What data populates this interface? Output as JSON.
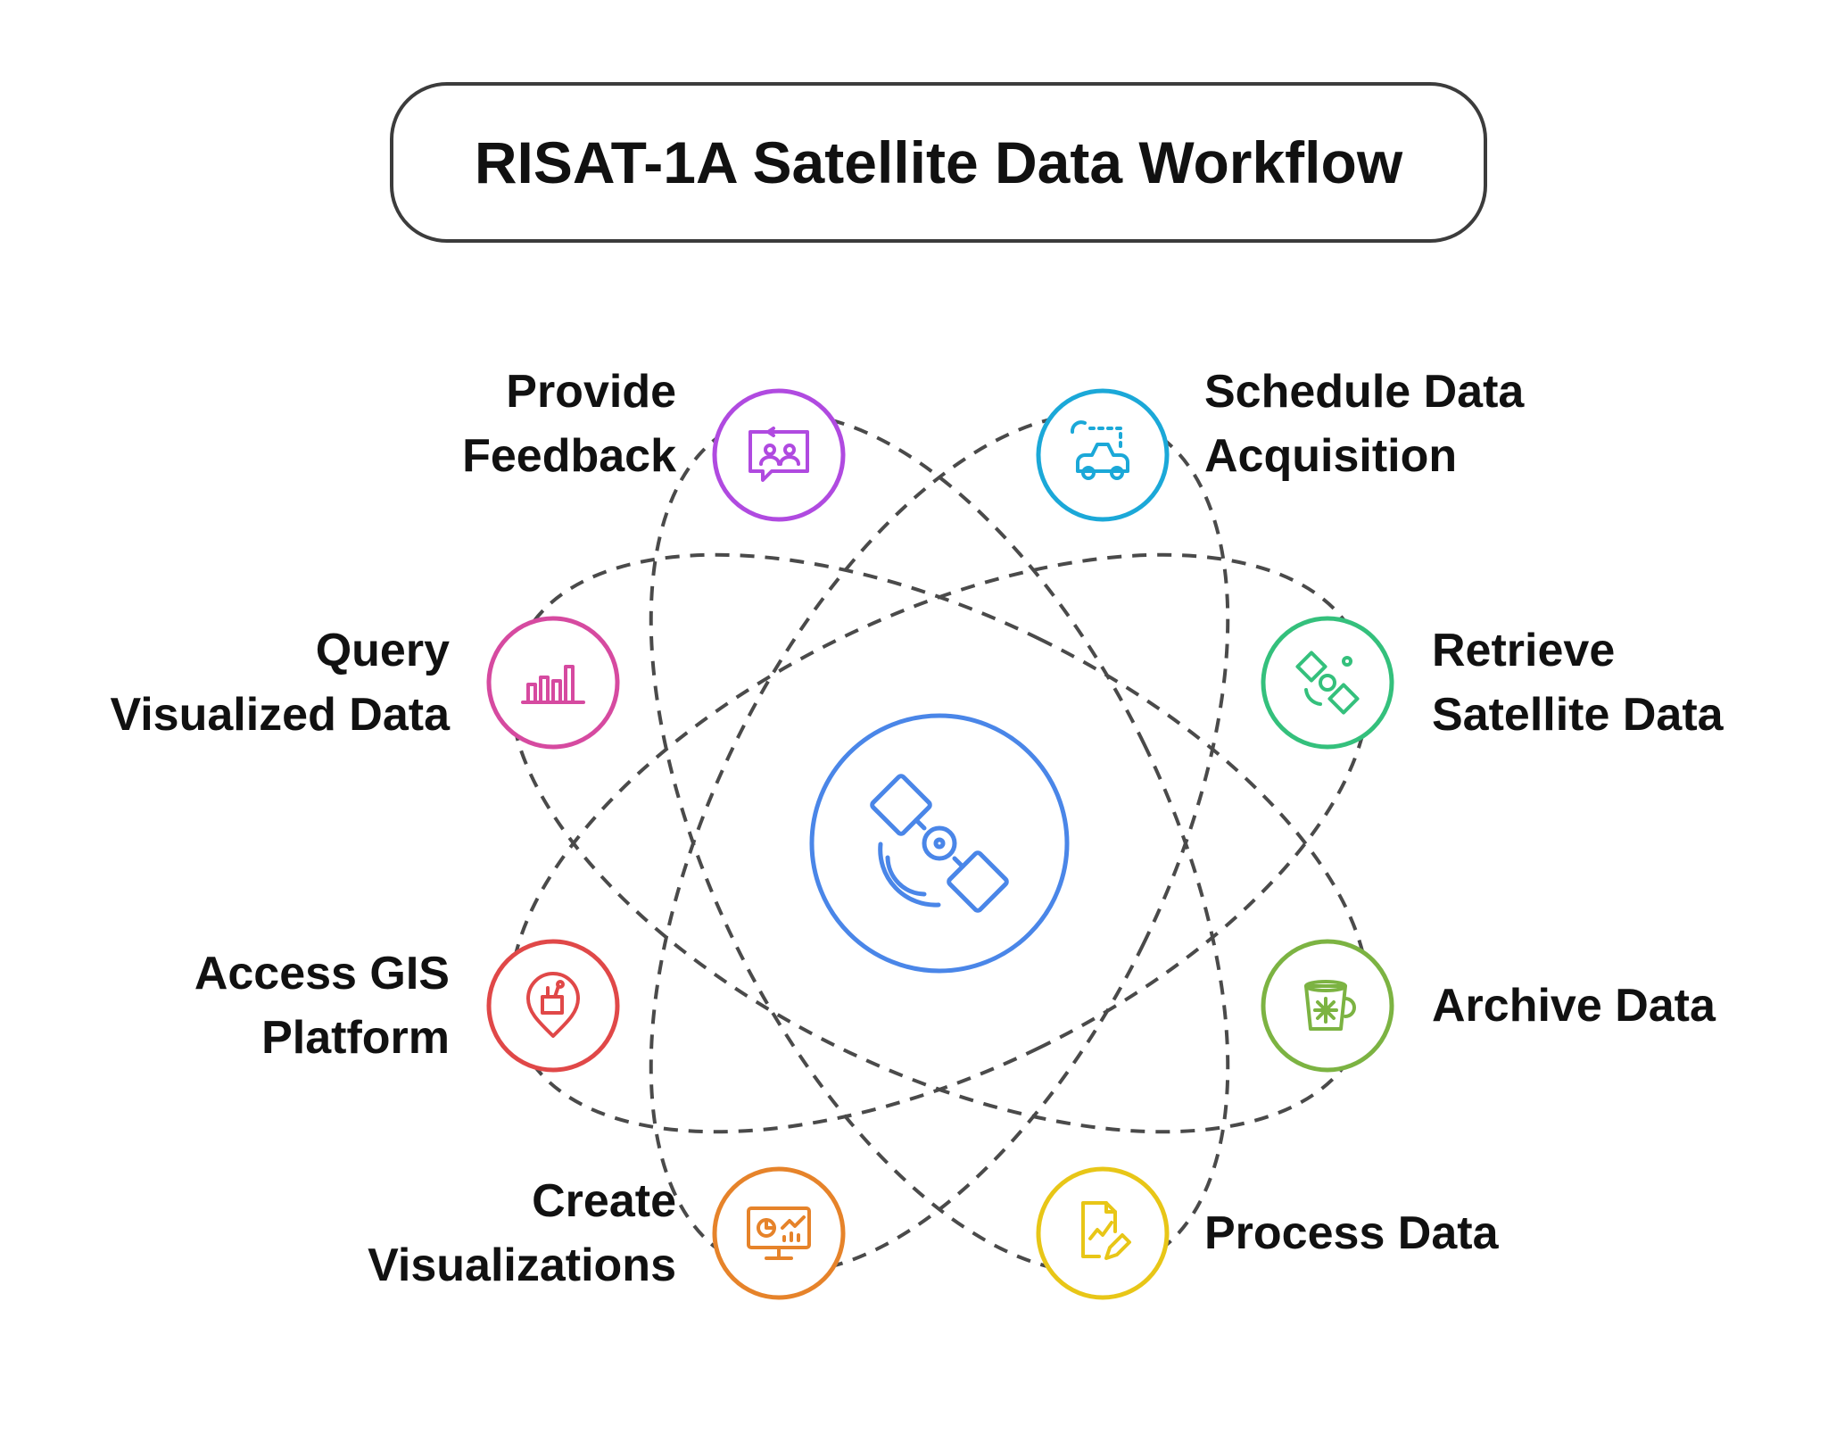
{
  "title": "RISAT-1A Satellite Data Workflow",
  "center": {
    "icon": "satellite-icon",
    "color": "#4a86e8"
  },
  "steps": [
    {
      "lines": [
        "Schedule Data",
        "Acquisition"
      ],
      "icon": "satellite-dish-car-icon",
      "color": "#1ba8d8"
    },
    {
      "lines": [
        "Retrieve",
        "Satellite Data"
      ],
      "icon": "satellite-icon",
      "color": "#34c07c"
    },
    {
      "lines": [
        "Archive Data"
      ],
      "icon": "snowflake-bucket-icon",
      "color": "#7cb342"
    },
    {
      "lines": [
        "Process Data"
      ],
      "icon": "document-edit-icon",
      "color": "#e8c617"
    },
    {
      "lines": [
        "Create",
        "Visualizations"
      ],
      "icon": "dashboard-monitor-icon",
      "color": "#e6832a"
    },
    {
      "lines": [
        "Access GIS",
        "Platform"
      ],
      "icon": "map-pin-tools-icon",
      "color": "#e04848"
    },
    {
      "lines": [
        "Query",
        "Visualized Data"
      ],
      "icon": "bar-chart-icon",
      "color": "#d64aa0"
    },
    {
      "lines": [
        "Provide",
        "Feedback"
      ],
      "icon": "feedback-users-icon",
      "color": "#b04ae0"
    }
  ]
}
